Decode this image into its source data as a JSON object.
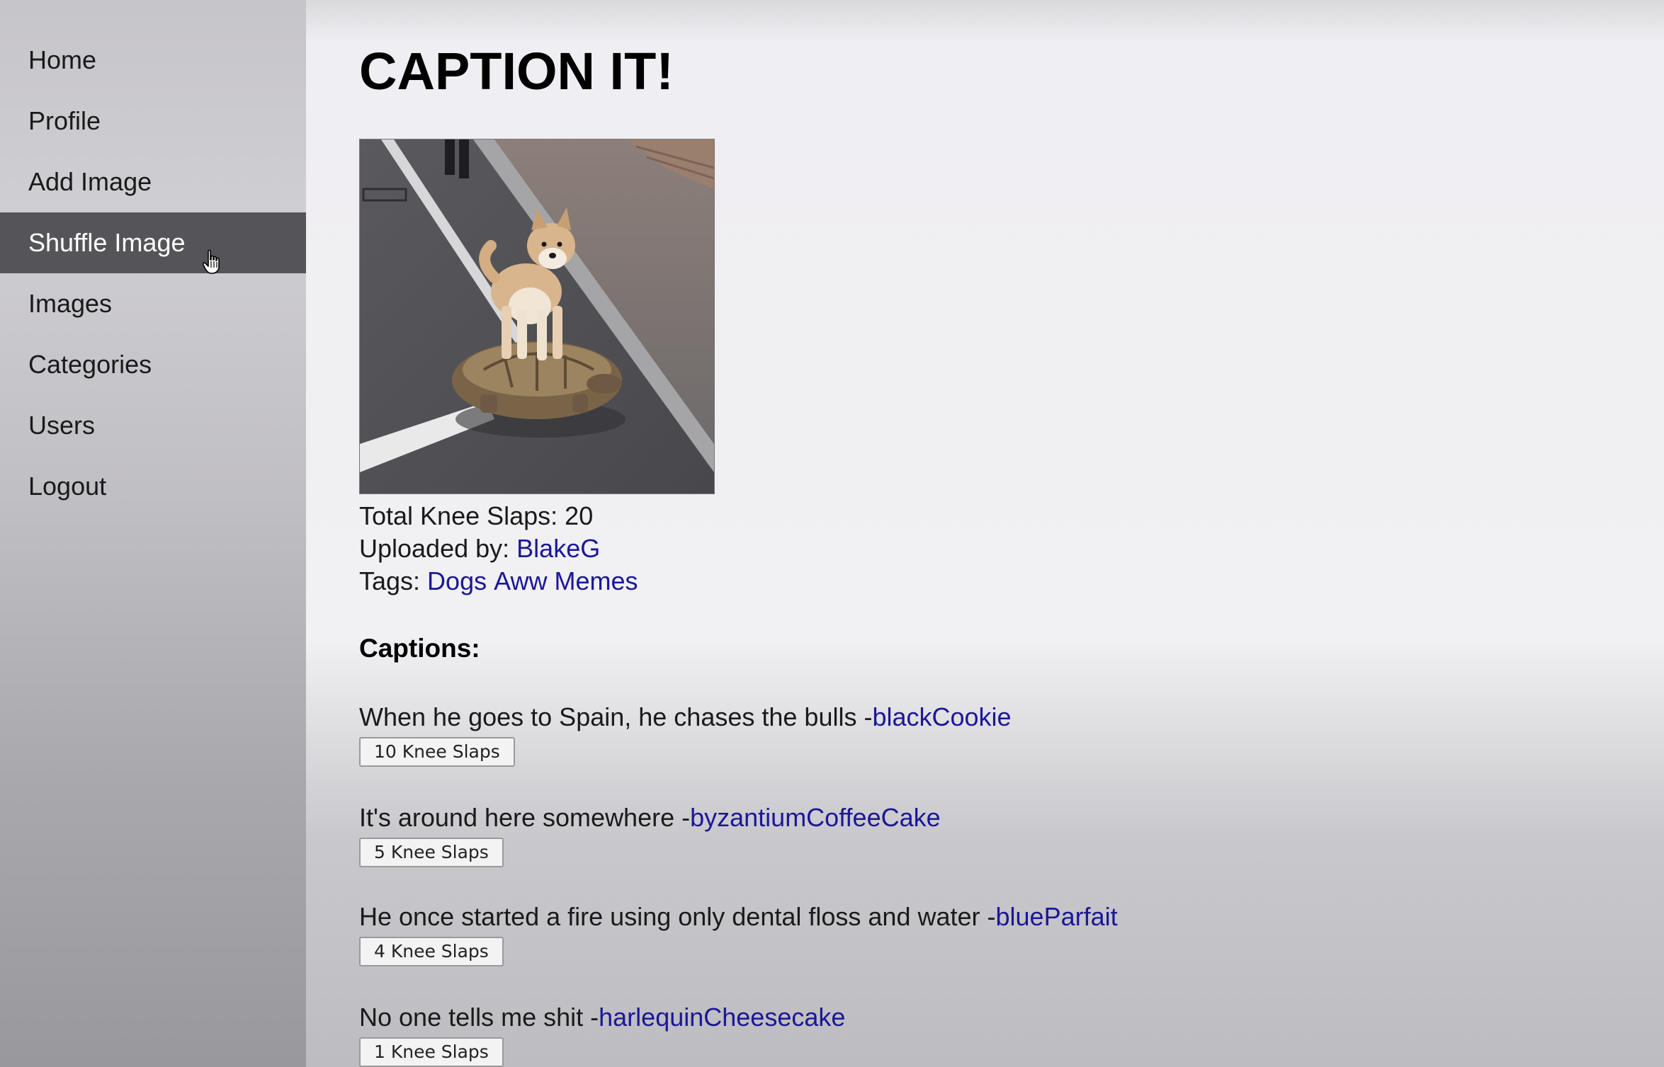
{
  "sidebar": {
    "items": [
      {
        "label": "Home"
      },
      {
        "label": "Profile"
      },
      {
        "label": "Add Image"
      },
      {
        "label": "Shuffle Image",
        "active": true
      },
      {
        "label": "Images"
      },
      {
        "label": "Categories"
      },
      {
        "label": "Users"
      },
      {
        "label": "Logout"
      }
    ]
  },
  "main": {
    "title": "CAPTION IT!",
    "image": {
      "alt": "Shiba Inu dog standing on top of a tortoise in the street"
    },
    "total_slaps_label": "Total Knee Slaps: 20",
    "uploaded_by_label": "Uploaded by: ",
    "uploader": "BlakeG",
    "tags_label": "Tags: ",
    "tags": [
      "Dogs",
      "Aww",
      "Memes"
    ],
    "captions_heading": "Captions:",
    "captions": [
      {
        "text": "When he goes to Spain, he chases the bulls -",
        "author": "blackCookie",
        "slaps_label": "10 Knee Slaps"
      },
      {
        "text": "It's around here somewhere -",
        "author": "byzantiumCoffeeCake",
        "slaps_label": "5 Knee Slaps"
      },
      {
        "text": "He once started a fire using only dental floss and water -",
        "author": "blueParfait",
        "slaps_label": "4 Knee Slaps"
      },
      {
        "text": "No one tells me shit -",
        "author": "harlequinCheesecake",
        "slaps_label": "1 Knee Slaps"
      }
    ]
  },
  "colors": {
    "link": "#1b1796",
    "active_nav_bg": "#555458",
    "active_nav_text": "#ffffff"
  },
  "icons": {
    "cursor": "hand-pointer-icon"
  }
}
